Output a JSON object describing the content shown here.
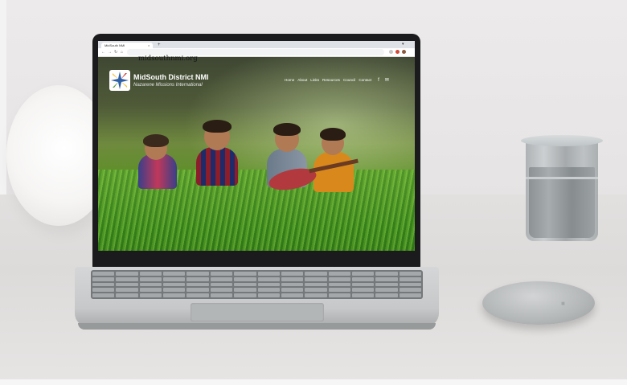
{
  "browser": {
    "tab_title": "MidSouth NMI",
    "new_tab": "+",
    "tab_close": "×",
    "url_overlay": "midsouthnmi.org"
  },
  "site": {
    "title": "MidSouth District NMI",
    "subtitle": "Nazarene Missions International",
    "nav": [
      "Home",
      "About",
      "Links",
      "Resources",
      "Council",
      "Contact"
    ],
    "social_icons": [
      "facebook-icon",
      "mail-icon"
    ]
  },
  "colors": {
    "logo_blue": "#2b5fa8",
    "logo_yellow": "#f2c230",
    "logo_red": "#c8302c",
    "logo_green": "#4a9a3a"
  }
}
